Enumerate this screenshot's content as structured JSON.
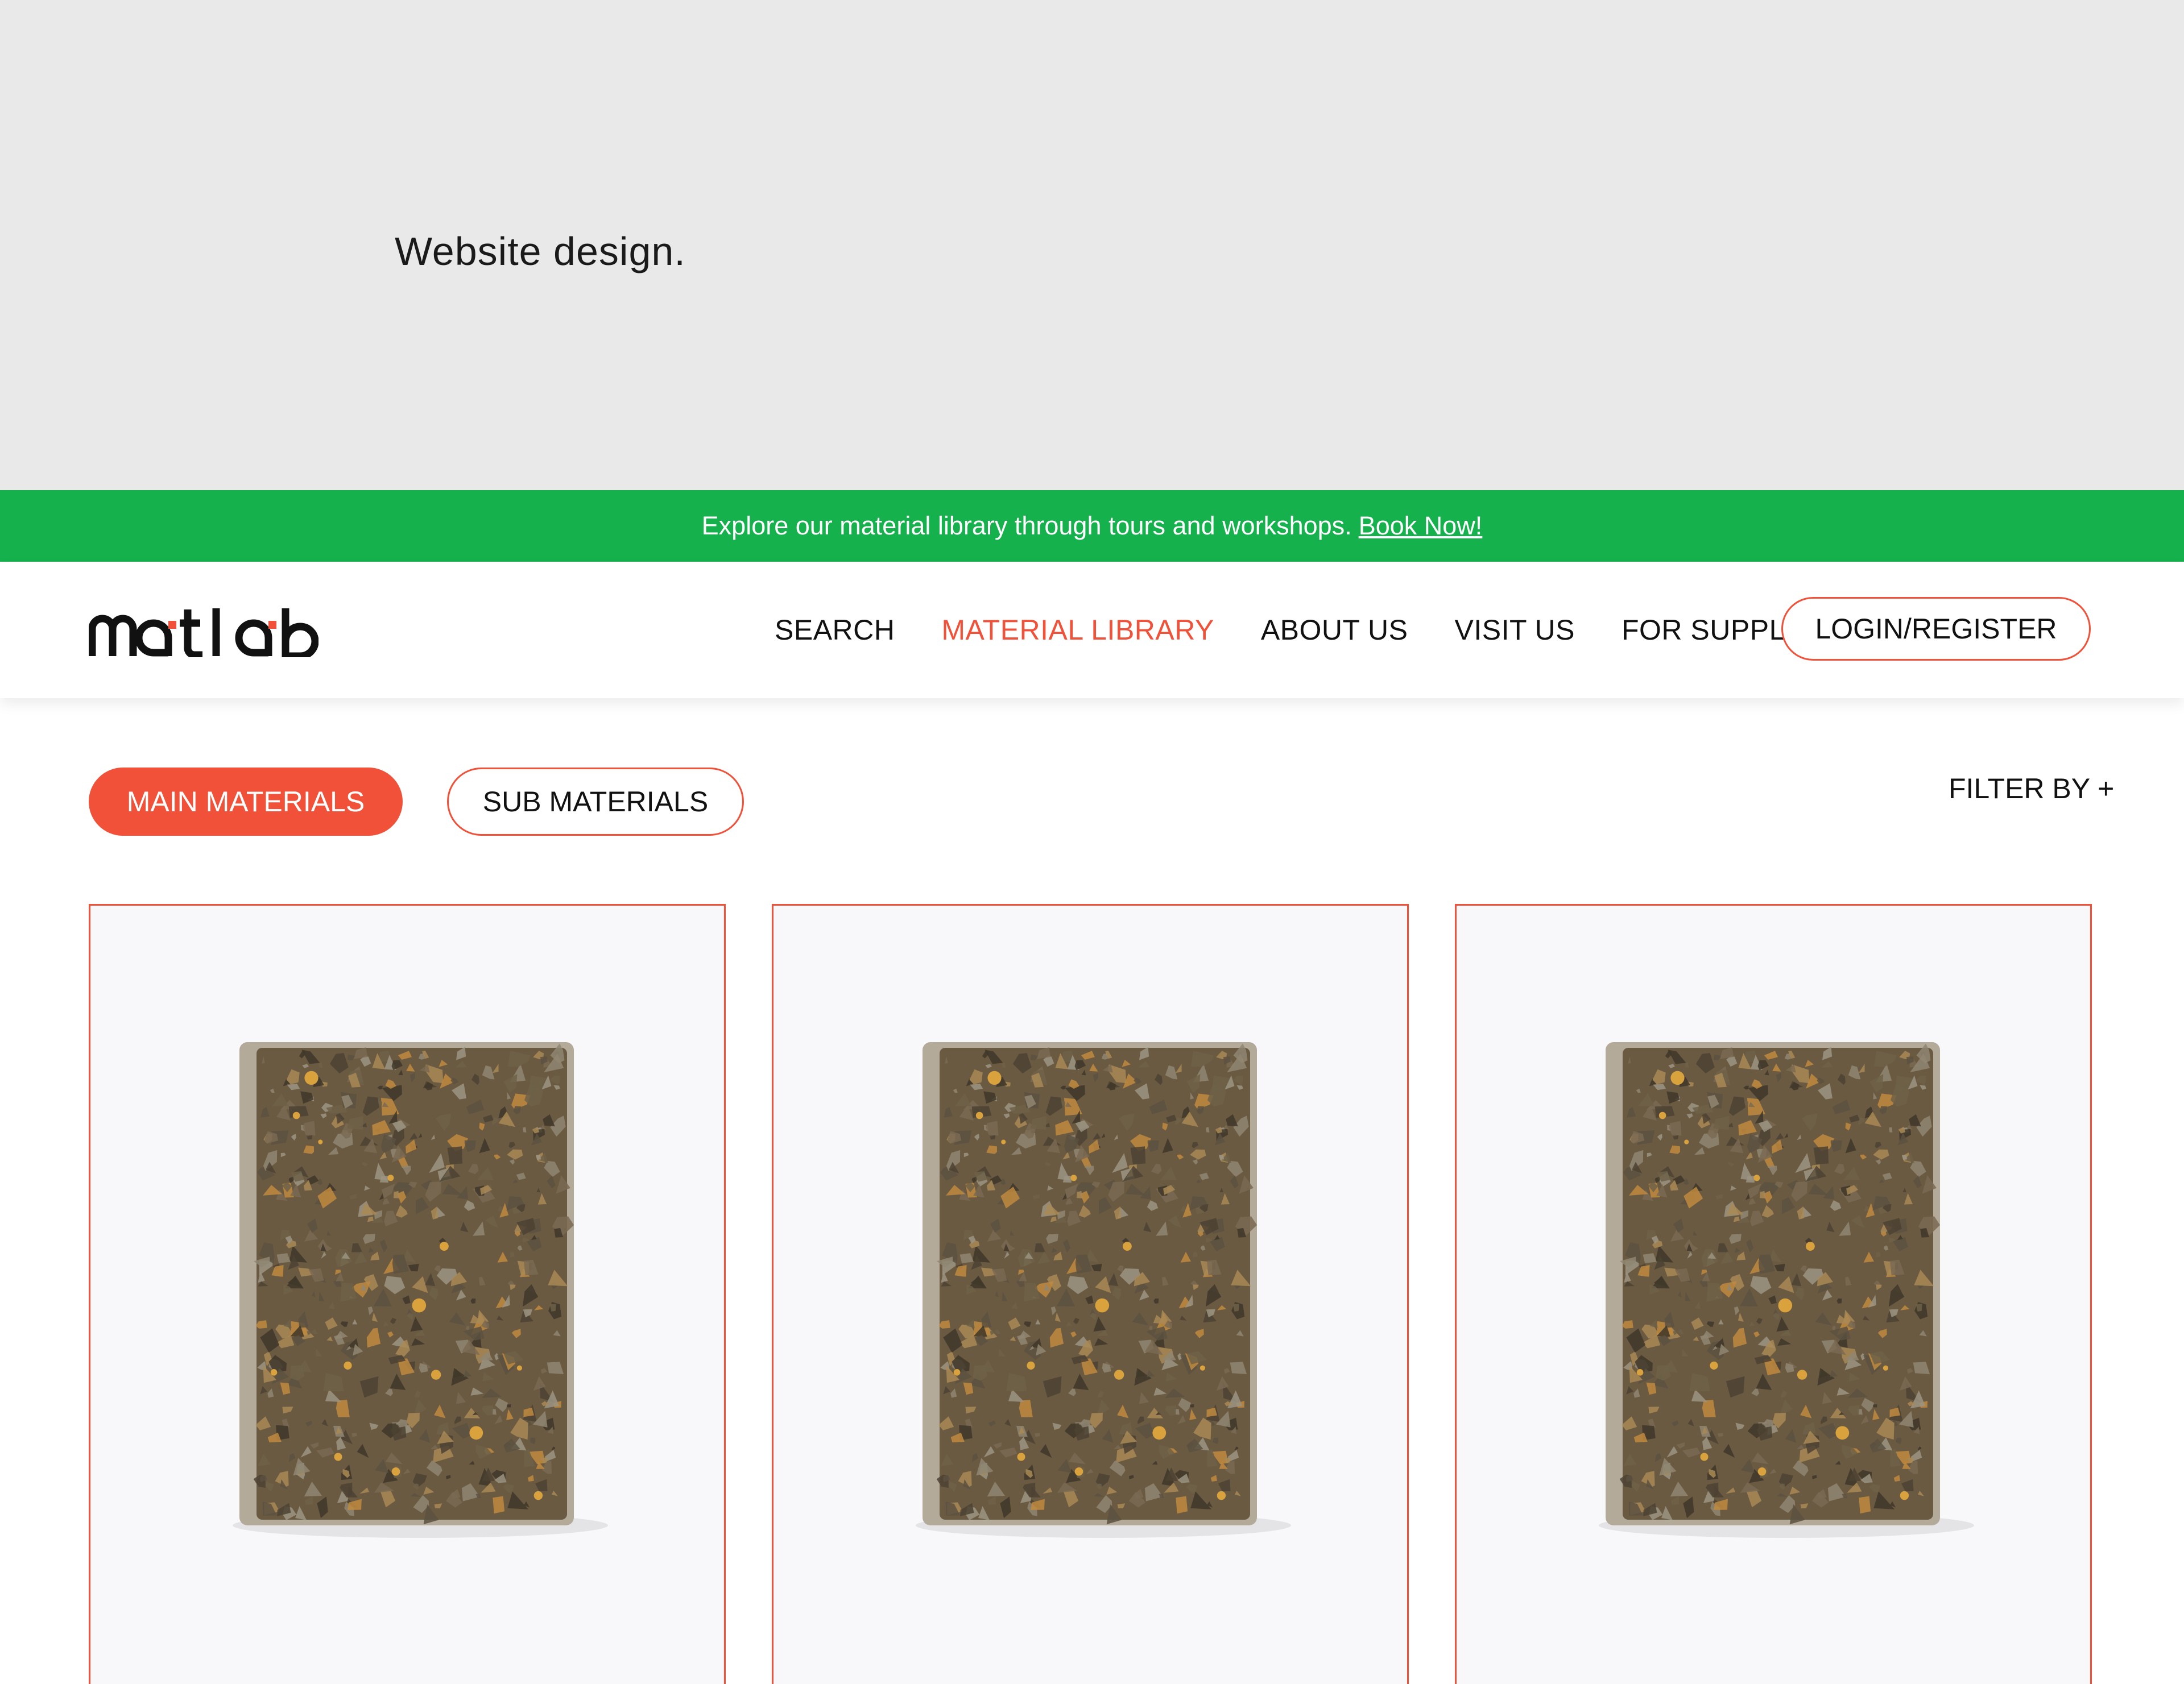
{
  "caption": {
    "text": "Website design."
  },
  "announcement": {
    "text": "Explore our material library through tours and workshops.",
    "link_label": "Book Now!",
    "background": "#14b14c"
  },
  "logo": {
    "text": "matlab"
  },
  "nav": {
    "items": [
      {
        "label": "SEARCH",
        "active": false
      },
      {
        "label": "MATERIAL LIBRARY",
        "active": true
      },
      {
        "label": "ABOUT US",
        "active": false
      },
      {
        "label": "VISIT US",
        "active": false
      },
      {
        "label": "FOR SUPPLIERS",
        "active": false
      }
    ],
    "login_label": "LOGIN/REGISTER"
  },
  "tabs": {
    "main_label": "MAIN MATERIALS",
    "sub_label": "SUB MATERIALS",
    "active": "main"
  },
  "filter": {
    "label": "FILTER BY +"
  },
  "cards": [
    {
      "icon": "material-sample-image"
    },
    {
      "icon": "material-sample-image"
    },
    {
      "icon": "material-sample-image"
    }
  ],
  "colors": {
    "accent": "#f05138",
    "banner_green": "#14b14c",
    "caption_bg": "#e9e9ea",
    "sample_brown": "#6b5a42"
  }
}
